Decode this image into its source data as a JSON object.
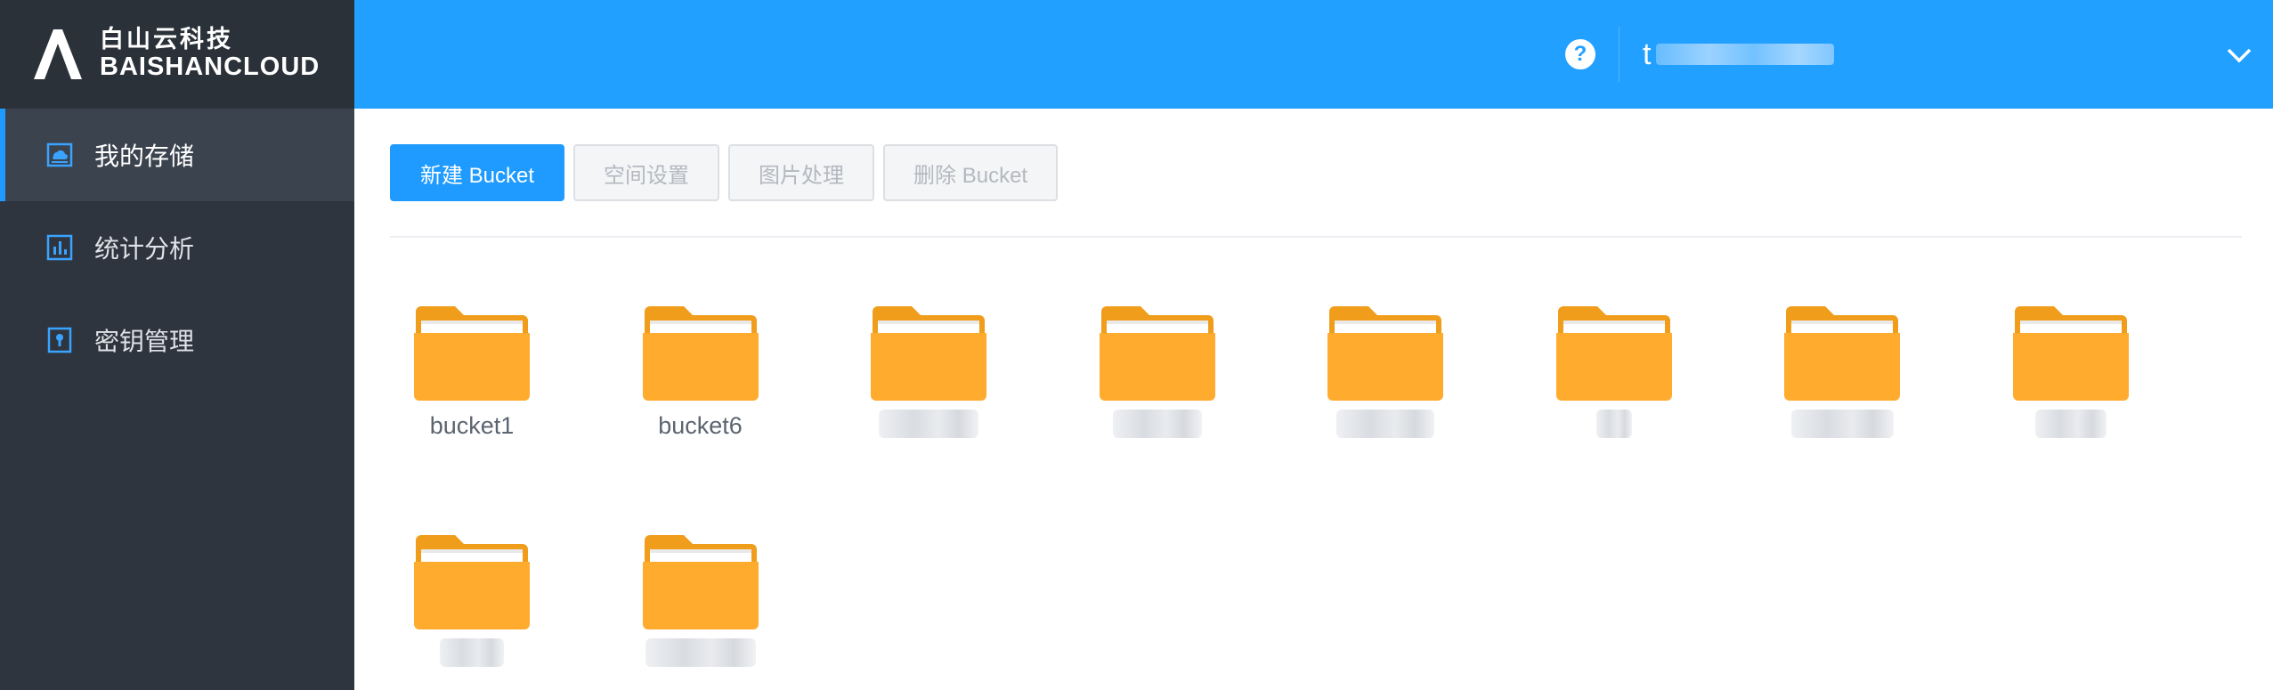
{
  "logo": {
    "cn": "白山云科技",
    "en": "BAISHANCLOUD"
  },
  "sidebar": {
    "items": [
      {
        "label": "我的存储",
        "icon": "storage-icon",
        "active": true
      },
      {
        "label": "统计分析",
        "icon": "bar-chart-icon",
        "active": false
      },
      {
        "label": "密钥管理",
        "icon": "key-icon",
        "active": false
      }
    ]
  },
  "header": {
    "help_label": "?",
    "user_visible_initial": "t",
    "colors": {
      "bar": "#22a0ff",
      "accent": "#1f9bff"
    }
  },
  "toolbar": {
    "new_bucket": "新建 Bucket",
    "space_settings": "空间设置",
    "image_processing": "图片处理",
    "delete_bucket": "删除 Bucket"
  },
  "buckets": [
    {
      "name": "bucket1"
    },
    {
      "name": "bucket6"
    },
    {
      "name": "",
      "obscured": true
    },
    {
      "name": "",
      "obscured": true
    },
    {
      "name": "",
      "obscured": true
    },
    {
      "name": "",
      "obscured": true
    },
    {
      "name": "",
      "obscured": true
    },
    {
      "name": "",
      "obscured": true
    },
    {
      "name": "",
      "obscured": true
    },
    {
      "name": "",
      "obscured": true
    }
  ],
  "folder_color": "#ffab2e"
}
